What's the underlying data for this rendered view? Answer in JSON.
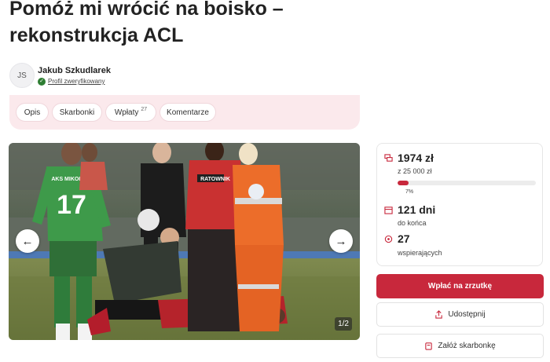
{
  "page": {
    "title": "Pomóż mi wrócić na boisko – rekonstrukcja ACL"
  },
  "author": {
    "initials": "JS",
    "name": "Jakub Szkudlarek",
    "verified_label": "Profil zweryfikowany"
  },
  "tabs": [
    {
      "label": "Opis"
    },
    {
      "label": "Skarbonki"
    },
    {
      "label": "Wpłaty",
      "count": "27"
    },
    {
      "label": "Komentarze"
    }
  ],
  "gallery": {
    "counter": "1/2",
    "jersey_text": "AKS MIKOŁÓW",
    "jersey_number": "17",
    "medic_text": "RATOWNIK",
    "prev_icon": "arrow-left-icon",
    "next_icon": "arrow-right-icon"
  },
  "stats": {
    "raised": "1974 zł",
    "goal": "z 25 000 zł",
    "percent_label": "7%",
    "progress_fraction": 0.079,
    "days_left": "121 dni",
    "days_label": "do końca",
    "supporters": "27",
    "supporters_label": "wspierających"
  },
  "actions": {
    "donate": "Wpłać na zrzutkę",
    "share": "Udostępnij",
    "create_box": "Załóż skarbonkę"
  },
  "colors": {
    "accent": "#c8283c",
    "tabs_background": "#fbe9ec",
    "verified": "#2e7d32"
  }
}
